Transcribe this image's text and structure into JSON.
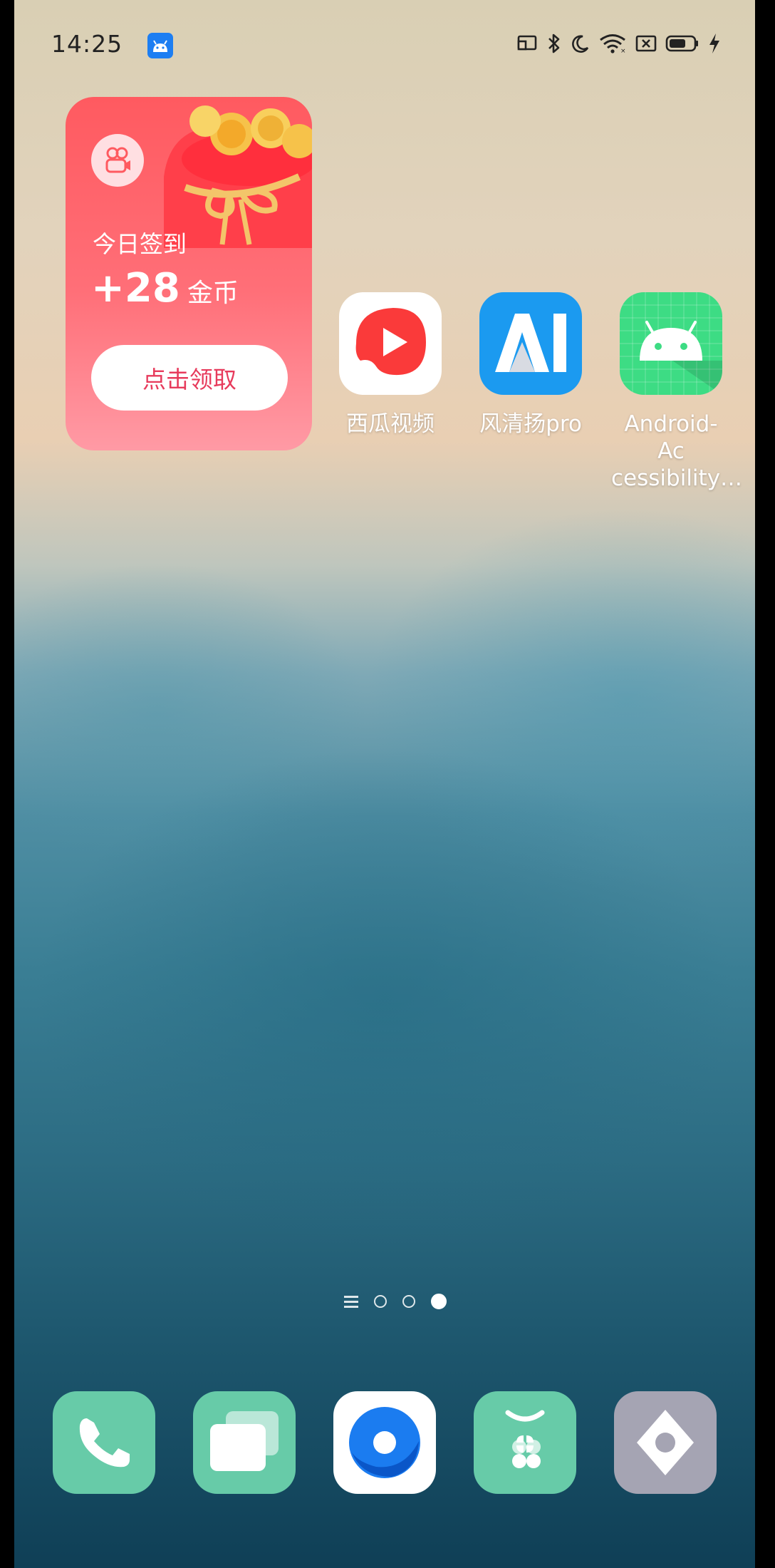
{
  "status_bar": {
    "time": "14:25",
    "notification_app_icon": "android-icon",
    "icons": [
      "screen-cast-icon",
      "bluetooth-icon",
      "moon-icon",
      "wifi-icon",
      "x-box-icon",
      "battery-icon",
      "charging-bolt-icon"
    ]
  },
  "widget": {
    "logo_icon": "video-camera-icon",
    "title": "今日签到",
    "amount": "+28",
    "unit": "金币",
    "button_label": "点击领取"
  },
  "apps": [
    {
      "label": "西瓜视频",
      "icon": "xigua-video-icon"
    },
    {
      "label": "风清扬pro",
      "icon": "ai-icon"
    },
    {
      "label": "Android-Ac\ncessibility…",
      "icon": "android-icon"
    }
  ],
  "page_indicator": {
    "pages": 3,
    "active_index": 2,
    "has_list_icon": true
  },
  "dock": [
    {
      "icon": "phone-icon"
    },
    {
      "icon": "messages-icon"
    },
    {
      "icon": "browser-icon"
    },
    {
      "icon": "app-store-icon"
    },
    {
      "icon": "settings-icon"
    }
  ],
  "colors": {
    "widget_red": "#ff5a60",
    "button_text": "#e73b5c",
    "dock_green": "#67cba8",
    "android_green": "#3ddc84",
    "ai_blue": "#1b9af0"
  }
}
